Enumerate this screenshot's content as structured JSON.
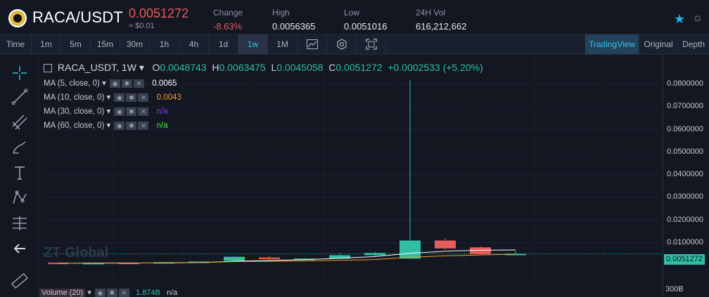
{
  "header": {
    "pair": "RACA/USDT",
    "price": "0.0051272",
    "price_usd": "≈ $0.01",
    "change_label": "Change",
    "change_value": "-8.63%",
    "high_label": "High",
    "high_value": "0.0056365",
    "low_label": "Low",
    "low_value": "0.0051016",
    "vol_label": "24H Vol",
    "vol_value": "616,212,662",
    "star_icon": "★",
    "gear_icon": "☼"
  },
  "toolbar": {
    "intervals": [
      "Time",
      "1m",
      "5m",
      "15m",
      "30m",
      "1h",
      "4h",
      "1d",
      "1w",
      "1M"
    ],
    "active_interval": "1w",
    "views": [
      "TradingView",
      "Original",
      "Depth"
    ],
    "active_view": "TradingView"
  },
  "legend": {
    "symbol": "RACA_USDT",
    "interval": "1W",
    "o_label": "O",
    "o_value": "0.0048743",
    "h_label": "H",
    "h_value": "0.0063475",
    "l_label": "L",
    "l_value": "0.0045058",
    "c_label": "C",
    "c_value": "0.0051272",
    "change": "+0.0002533 (+5.20%)"
  },
  "ma": [
    {
      "label": "MA (5, close, 0)",
      "value": "0.0065",
      "color": "#ffffff"
    },
    {
      "label": "MA (10, close, 0)",
      "value": "0.0043",
      "color": "#f0a020"
    },
    {
      "label": "MA (30, close, 0)",
      "value": "n/a",
      "color": "#7b3fe4"
    },
    {
      "label": "MA (60, close, 0)",
      "value": "n/a",
      "color": "#4ce04c"
    }
  ],
  "yaxis": [
    "0.0800000",
    "0.0700000",
    "0.0600000",
    "0.0500000",
    "0.0400000",
    "0.0300000",
    "0.0200000",
    "0.0100000"
  ],
  "current_price_tag": "0.0051272",
  "volume": {
    "label": "Volume (20)",
    "value": "1.874B",
    "extra": "n/a",
    "axis_label": "300B"
  },
  "watermark": "ZT Global",
  "colors": {
    "up": "#2fbfa5",
    "down": "#e65b5b",
    "accent": "#2ec4e6"
  },
  "chart_data": {
    "type": "candlestick",
    "ylim": [
      0,
      0.085
    ],
    "candles": [
      {
        "o": 0.0012,
        "h": 0.0013,
        "l": 0.0008,
        "c": 0.0009
      },
      {
        "o": 0.001,
        "h": 0.0012,
        "l": 0.0009,
        "c": 0.0011
      },
      {
        "o": 0.0012,
        "h": 0.0014,
        "l": 0.001,
        "c": 0.0011
      },
      {
        "o": 0.0013,
        "h": 0.0015,
        "l": 0.0011,
        "c": 0.0014
      },
      {
        "o": 0.0012,
        "h": 0.0018,
        "l": 0.0011,
        "c": 0.0017
      },
      {
        "o": 0.002,
        "h": 0.004,
        "l": 0.0018,
        "c": 0.0038
      },
      {
        "o": 0.0035,
        "h": 0.004,
        "l": 0.0026,
        "c": 0.0028
      },
      {
        "o": 0.0026,
        "h": 0.0032,
        "l": 0.0024,
        "c": 0.003
      },
      {
        "o": 0.003,
        "h": 0.0055,
        "l": 0.0028,
        "c": 0.0045
      },
      {
        "o": 0.0045,
        "h": 0.006,
        "l": 0.004,
        "c": 0.0055
      },
      {
        "o": 0.003,
        "h": 0.082,
        "l": 0.0028,
        "c": 0.011
      },
      {
        "o": 0.011,
        "h": 0.012,
        "l": 0.007,
        "c": 0.0075
      },
      {
        "o": 0.008,
        "h": 0.0085,
        "l": 0.0045,
        "c": 0.005
      },
      {
        "o": 0.0048743,
        "h": 0.0063475,
        "l": 0.0045058,
        "c": 0.0051272
      }
    ]
  }
}
